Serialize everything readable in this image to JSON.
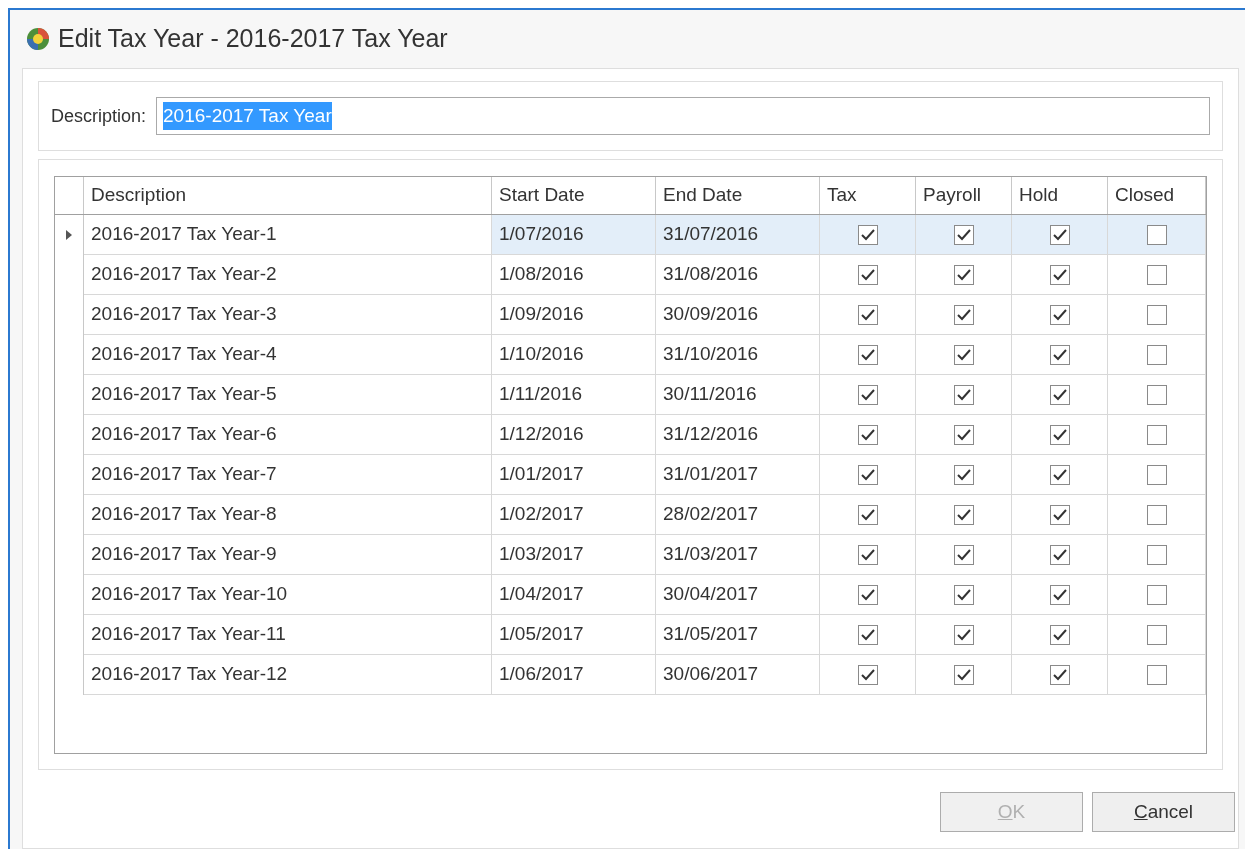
{
  "window": {
    "title": "Edit Tax Year - 2016-2017 Tax Year"
  },
  "description_field": {
    "label": "Description:",
    "value": "2016-2017 Tax Year",
    "text_selected": true
  },
  "table": {
    "columns": [
      "Description",
      "Start Date",
      "End Date",
      "Tax",
      "Payroll",
      "Hold",
      "Closed"
    ],
    "rows": [
      {
        "selected": true,
        "description": "2016-2017 Tax Year-1",
        "start": "1/07/2016",
        "end": "31/07/2016",
        "tax": true,
        "payroll": true,
        "hold": true,
        "closed": false
      },
      {
        "selected": false,
        "description": "2016-2017 Tax Year-2",
        "start": "1/08/2016",
        "end": "31/08/2016",
        "tax": true,
        "payroll": true,
        "hold": true,
        "closed": false
      },
      {
        "selected": false,
        "description": "2016-2017 Tax Year-3",
        "start": "1/09/2016",
        "end": "30/09/2016",
        "tax": true,
        "payroll": true,
        "hold": true,
        "closed": false
      },
      {
        "selected": false,
        "description": "2016-2017 Tax Year-4",
        "start": "1/10/2016",
        "end": "31/10/2016",
        "tax": true,
        "payroll": true,
        "hold": true,
        "closed": false
      },
      {
        "selected": false,
        "description": "2016-2017 Tax Year-5",
        "start": "1/11/2016",
        "end": "30/11/2016",
        "tax": true,
        "payroll": true,
        "hold": true,
        "closed": false
      },
      {
        "selected": false,
        "description": "2016-2017 Tax Year-6",
        "start": "1/12/2016",
        "end": "31/12/2016",
        "tax": true,
        "payroll": true,
        "hold": true,
        "closed": false
      },
      {
        "selected": false,
        "description": "2016-2017 Tax Year-7",
        "start": "1/01/2017",
        "end": "31/01/2017",
        "tax": true,
        "payroll": true,
        "hold": true,
        "closed": false
      },
      {
        "selected": false,
        "description": "2016-2017 Tax Year-8",
        "start": "1/02/2017",
        "end": "28/02/2017",
        "tax": true,
        "payroll": true,
        "hold": true,
        "closed": false
      },
      {
        "selected": false,
        "description": "2016-2017 Tax Year-9",
        "start": "1/03/2017",
        "end": "31/03/2017",
        "tax": true,
        "payroll": true,
        "hold": true,
        "closed": false
      },
      {
        "selected": false,
        "description": "2016-2017 Tax Year-10",
        "start": "1/04/2017",
        "end": "30/04/2017",
        "tax": true,
        "payroll": true,
        "hold": true,
        "closed": false
      },
      {
        "selected": false,
        "description": "2016-2017 Tax Year-11",
        "start": "1/05/2017",
        "end": "31/05/2017",
        "tax": true,
        "payroll": true,
        "hold": true,
        "closed": false
      },
      {
        "selected": false,
        "description": "2016-2017 Tax Year-12",
        "start": "1/06/2017",
        "end": "30/06/2017",
        "tax": true,
        "payroll": true,
        "hold": true,
        "closed": false
      }
    ]
  },
  "buttons": [
    {
      "label": "OK",
      "disabled": true,
      "access_key": true
    },
    {
      "label": "Cancel",
      "disabled": false,
      "access_key": true
    }
  ]
}
